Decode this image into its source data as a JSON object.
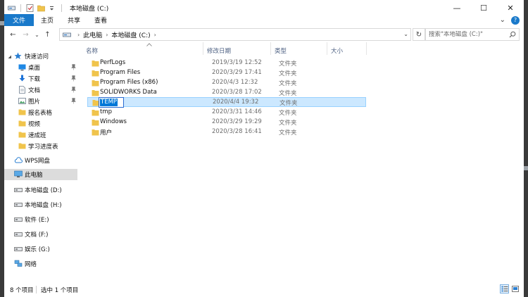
{
  "window": {
    "title": "本地磁盘 (C:)",
    "controls": {
      "minimize": "—",
      "maximize": "☐",
      "close": "✕"
    }
  },
  "ribbon": {
    "tabs": [
      "文件",
      "主页",
      "共享",
      "查看"
    ],
    "help": "?",
    "expand": "⌄"
  },
  "address": {
    "crumbs": [
      "此电脑",
      "本地磁盘 (C:)"
    ],
    "separator": "›",
    "search_placeholder": "搜索\"本地磁盘 (C:)\""
  },
  "nav": {
    "back": "←",
    "forward": "→",
    "recent": "⌄",
    "up": "↑",
    "refresh": "↻",
    "quick_access": "快速访问",
    "pinned": [
      {
        "label": "桌面",
        "icon": "desktop-icon"
      },
      {
        "label": "下载",
        "icon": "download-icon"
      },
      {
        "label": "文档",
        "icon": "documents-icon"
      },
      {
        "label": "图片",
        "icon": "pictures-icon"
      }
    ],
    "folders": [
      "报名表格",
      "视频",
      "速成班",
      "学习进度表"
    ],
    "wps": "WPS网盘",
    "this_pc": "此电脑",
    "drives": [
      "本地磁盘 (D:)",
      "本地磁盘 (H:)",
      "软件 (E:)",
      "文档 (F:)",
      "娱乐 (G:)"
    ],
    "network": "网络"
  },
  "columns": {
    "name": "名称",
    "date": "修改日期",
    "type": "类型",
    "size": "大小"
  },
  "files": [
    {
      "name": "PerfLogs",
      "date": "2019/3/19 12:52",
      "type": "文件夹"
    },
    {
      "name": "Program Files",
      "date": "2020/3/29 17:41",
      "type": "文件夹"
    },
    {
      "name": "Program Files (x86)",
      "date": "2020/4/3 12:32",
      "type": "文件夹"
    },
    {
      "name": "SOLIDWORKS Data",
      "date": "2020/3/28 17:02",
      "type": "文件夹"
    },
    {
      "name": "TEMP",
      "date": "2020/4/4 19:32",
      "type": "文件夹",
      "selected": true,
      "renaming": true
    },
    {
      "name": "tmp",
      "date": "2020/3/31 14:46",
      "type": "文件夹"
    },
    {
      "name": "Windows",
      "date": "2020/3/29 19:29",
      "type": "文件夹"
    },
    {
      "name": "用户",
      "date": "2020/3/28 16:41",
      "type": "文件夹"
    }
  ],
  "status": {
    "count": "8 个项目",
    "selection": "选中 1 个项目"
  },
  "colors": {
    "accent": "#1979ca",
    "selection": "#cce8ff",
    "folder": "#f0c44c"
  }
}
